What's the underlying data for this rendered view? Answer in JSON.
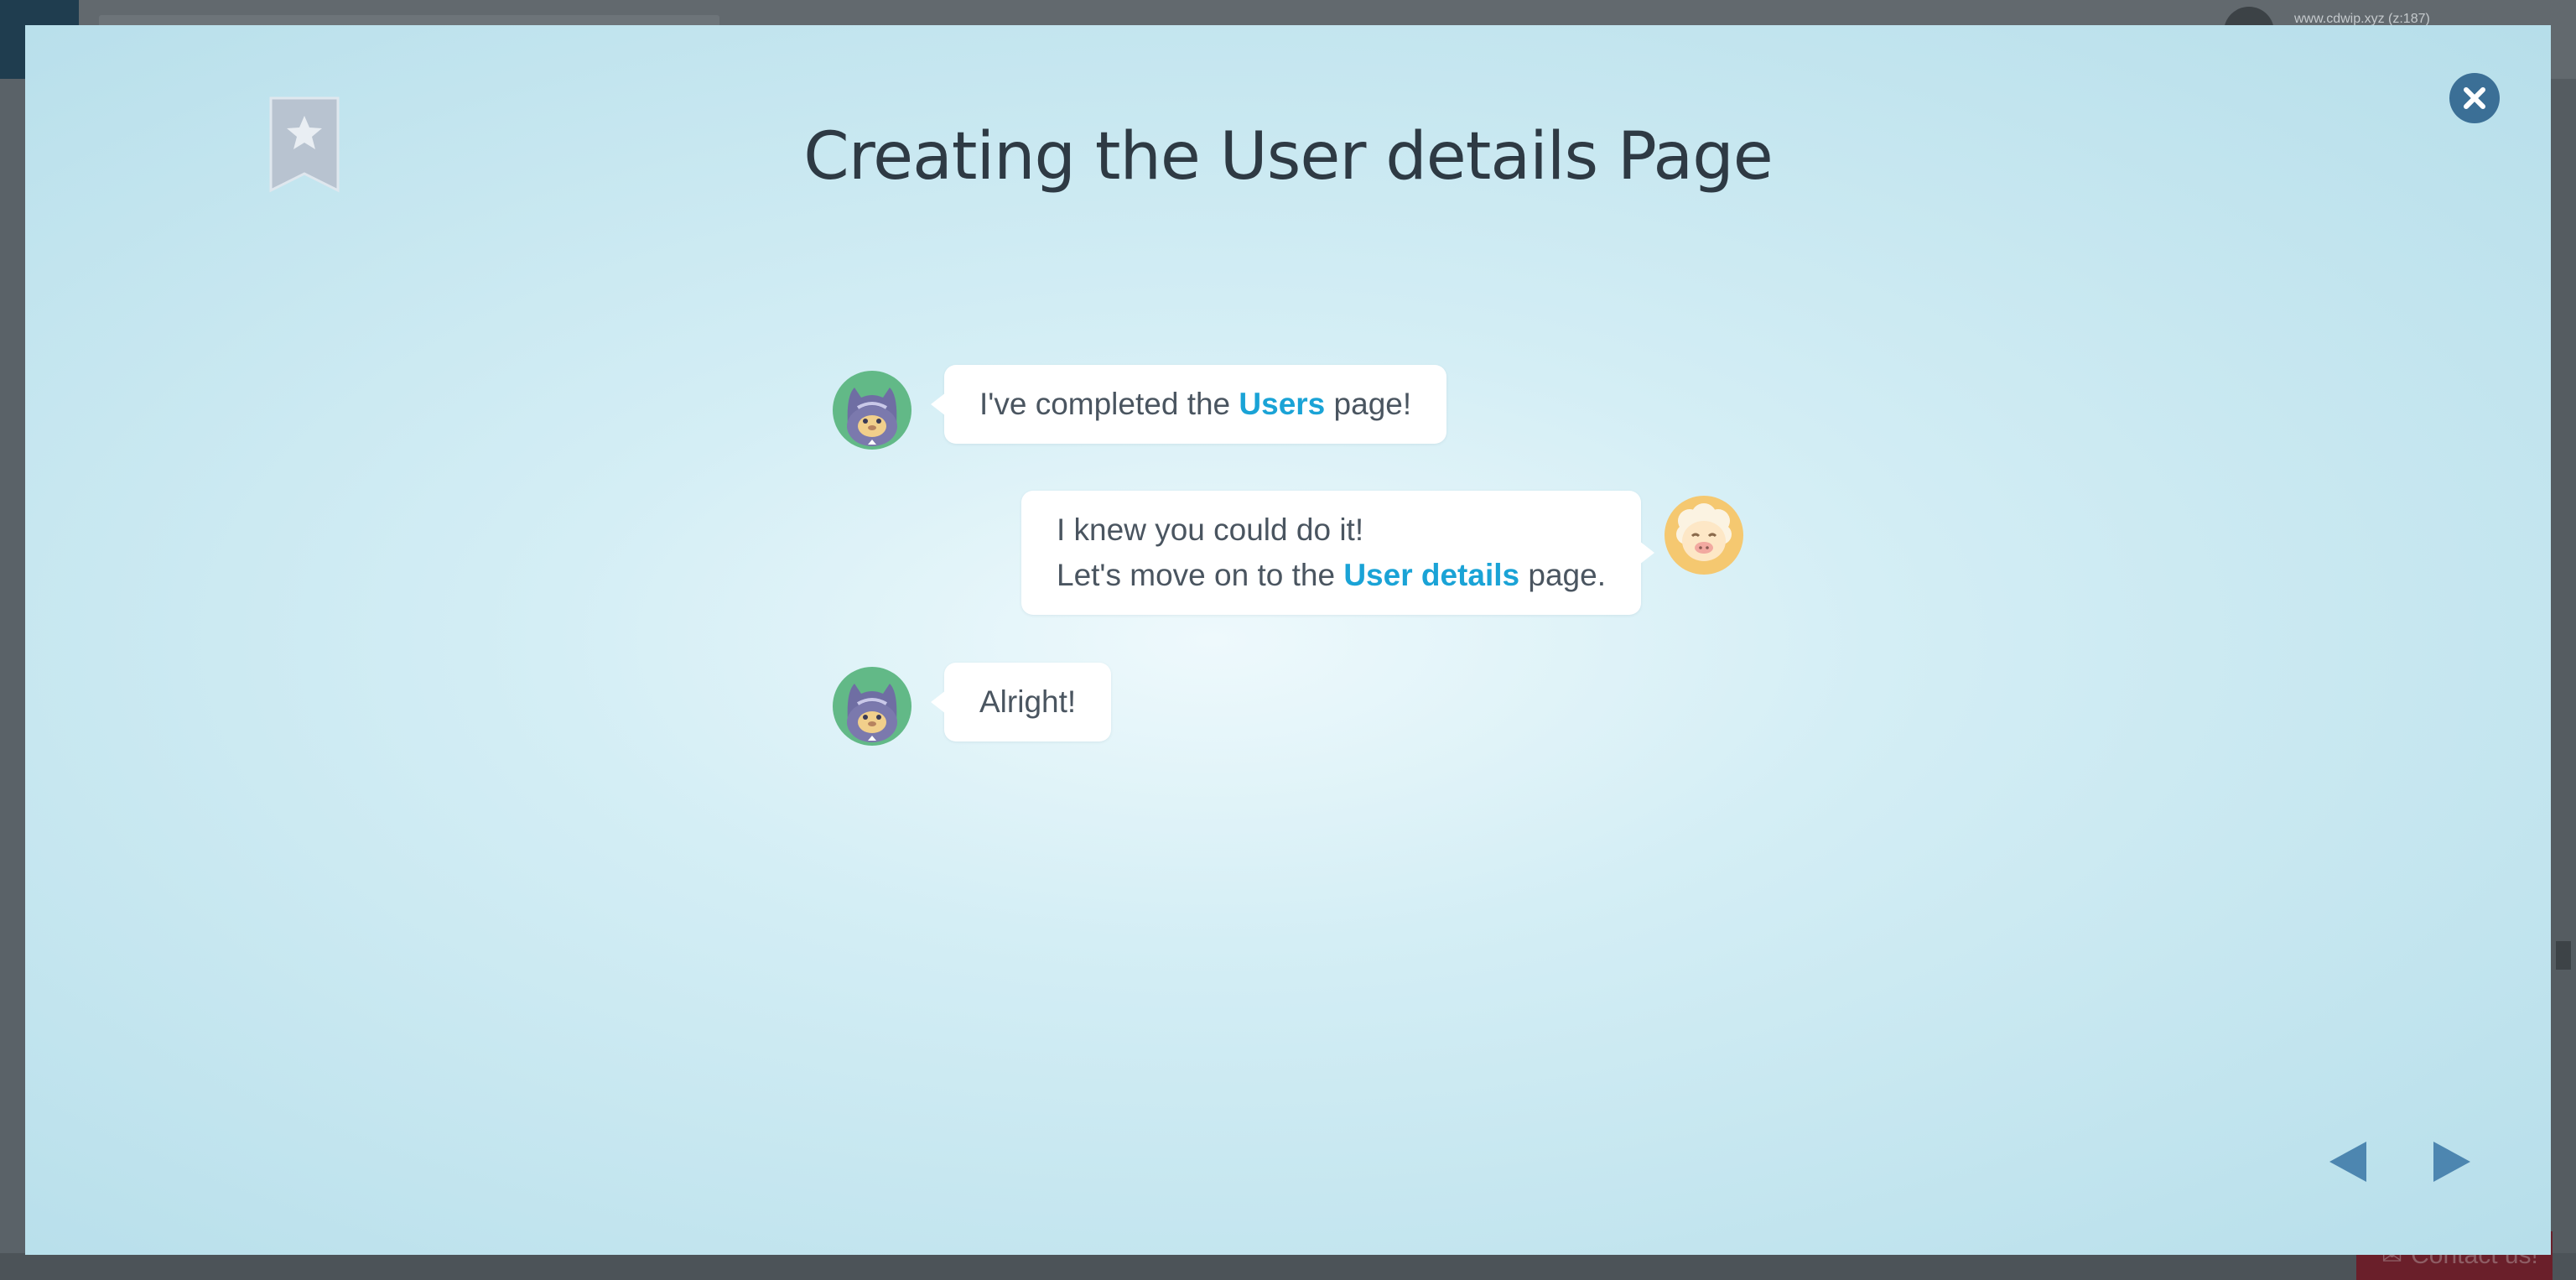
{
  "background": {
    "account_email": "www.cdwip.xyz (z:187)",
    "contact_label": "Contact us!"
  },
  "modal": {
    "title": "Creating the User details Page",
    "messages": [
      {
        "speaker": "cat",
        "side": "left",
        "lines": [
          [
            {
              "text": "I've completed the ",
              "highlight": false
            },
            {
              "text": "Users",
              "highlight": true
            },
            {
              "text": " page!",
              "highlight": false
            }
          ]
        ]
      },
      {
        "speaker": "sheep",
        "side": "right",
        "lines": [
          [
            {
              "text": "I knew you could do it!",
              "highlight": false
            }
          ],
          [
            {
              "text": "Let's move on to the ",
              "highlight": false
            },
            {
              "text": "User details",
              "highlight": true
            },
            {
              "text": " page.",
              "highlight": false
            }
          ]
        ]
      },
      {
        "speaker": "cat",
        "side": "left",
        "lines": [
          [
            {
              "text": "Alright!",
              "highlight": false
            }
          ]
        ]
      }
    ]
  },
  "icons": {
    "bookmark": "bookmark-star-icon",
    "close": "close-icon",
    "prev": "prev-arrow-icon",
    "next": "next-arrow-icon"
  },
  "colors": {
    "highlight": "#1aa3d6",
    "title": "#2e3a44",
    "close_button": "#3b6f96",
    "nav_arrow": "#4d86b0"
  }
}
